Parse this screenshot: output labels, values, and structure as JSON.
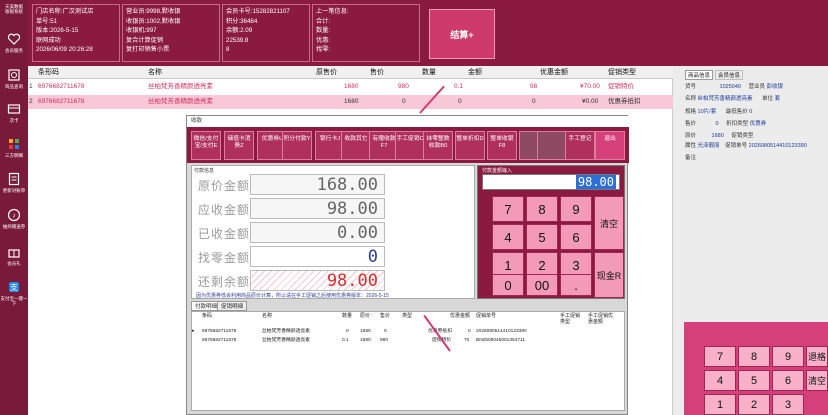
{
  "sidebar": {
    "logo_line1": "天美数据",
    "logo_line2": "收银系统",
    "items": [
      {
        "label": "会员服务",
        "icon": "heart-icon"
      },
      {
        "label": "商品查询",
        "icon": "search-icon"
      },
      {
        "label": "次卡",
        "icon": "card-icon"
      },
      {
        "label": "三方明细",
        "icon": "list-icon"
      },
      {
        "label": "更新对账单",
        "icon": "refresh-icon"
      },
      {
        "label": "抽商赠送券",
        "icon": "music-icon"
      },
      {
        "label": "会员礼",
        "icon": "gift-icon"
      },
      {
        "label": "支付宝一键一下",
        "icon": "alipay-icon"
      }
    ]
  },
  "topbar": {
    "store": [
      "门店名称:广汉测试店",
      "单号:51",
      "版本:2026-5-15",
      "联网成功",
      "2026/06/09 20:26:28"
    ],
    "cashier": [
      "营业员:9998,默收银",
      "收银员:1002,默收银",
      "收银机:997",
      "复合计算促销",
      "复打印销售小票"
    ],
    "member": [
      "会员卡号:15282821107",
      "积分:36484",
      "余额:2.09",
      "22539.8",
      "8"
    ],
    "last": [
      "上一笔信息:",
      "合计:",
      "数量:",
      "优惠:",
      "找零:"
    ],
    "settle_button": "结算+"
  },
  "grid": {
    "columns": [
      "条形码",
      "名称",
      "原售价",
      "售价",
      "数量",
      "金额",
      "优惠金额",
      "促销类型"
    ],
    "rows": [
      {
        "idx": "1",
        "barcode": "6976682711678",
        "name": "丝柏梵芳香精颜透亮素",
        "orig": "1680",
        "price": "980",
        "qty": "0.1",
        "amount": "98",
        "discount": "¥70.00",
        "promo": "促销特价"
      },
      {
        "idx": "2",
        "barcode": "6976682711678",
        "name": "丝柏梵芳香精颜透亮素",
        "orig": "1680",
        "price": "0",
        "qty": "0",
        "amount": "0",
        "discount": "¥0.00",
        "promo": "优惠券抵扣"
      }
    ]
  },
  "right_panel": {
    "tabs": [
      "商品信息",
      "会员信息"
    ],
    "lines": [
      {
        "k": "货号",
        "v": "1025040",
        "k2": "营业员",
        "v2": "彭收银"
      },
      {
        "k": "名称",
        "v": "丝柏梵芳香精颜透亮素",
        "k2": "单位",
        "v2": "套"
      },
      {
        "k": "规格",
        "v": "10片/套",
        "k2": "最低售价",
        "v2": "0"
      },
      {
        "k": "售价",
        "v": "0",
        "k2": "折扣类型",
        "v2": "优惠券"
      },
      {
        "k": "原价",
        "v": "1680",
        "k2": "促销类型",
        "v2": ""
      },
      {
        "k": "属性",
        "v": "光泽靓丽",
        "k2": "促销单号",
        "v2": "2026080514410123390"
      },
      {
        "k": "备注",
        "v": "",
        "k2": "",
        "v2": ""
      }
    ],
    "keypad": [
      "7",
      "8",
      "9",
      "退格",
      "4",
      "5",
      "6",
      "清空",
      "1",
      "2",
      "3"
    ]
  },
  "dialog": {
    "title": "收款",
    "toolbar": [
      {
        "label": "微信/支付宝/支付E"
      },
      {
        "label": "储值卡消费Z"
      },
      {
        "label": "优惠券L"
      },
      {
        "label": "积分付款Y"
      },
      {
        "label": "银行卡J"
      },
      {
        "label": "收款其它"
      },
      {
        "label": "有赠收款F7"
      },
      {
        "label": "手工促销C"
      },
      {
        "label": "抹零整数收款B0"
      },
      {
        "label": "整单折扣D"
      },
      {
        "label": "整单收银F8"
      },
      {
        "label": ""
      },
      {
        "label": ""
      },
      {
        "label": "手工登记"
      },
      {
        "label": "退出"
      }
    ],
    "section_label": "付款信息",
    "amounts": [
      {
        "label": "原价金额",
        "value": "168.00"
      },
      {
        "label": "应收金额",
        "value": "98.00"
      },
      {
        "label": "已收金额",
        "value": "0.00"
      },
      {
        "label": "找零金额",
        "value": "0"
      },
      {
        "label": "还剩余额",
        "value": "98.00"
      }
    ],
    "note": "因为优惠券低会利用商品原价计算，所以请在手工促销之后使用优惠券版本：2026-5-15",
    "input_label": "付款金额输入",
    "input_value": "98.00",
    "keypad": [
      "7",
      "8",
      "9",
      "清空",
      "4",
      "5",
      "6",
      "1",
      "2",
      "3",
      "现金R",
      "0",
      "00",
      "."
    ],
    "tabs": [
      "付款明细",
      "促销明细"
    ],
    "table_columns": [
      "条码",
      "名称",
      "数量",
      "原价",
      "售价",
      "类型",
      "优惠金额",
      "促销单号",
      "手工促销类型",
      "手工促销优惠金额"
    ],
    "table_rows": [
      {
        "barcode": "6976682711678",
        "name": "丝柏梵芳香精颜透亮素",
        "qty": "0",
        "orig": "1680",
        "price": "0",
        "type": "优惠券抵扣",
        "disc": "0",
        "no": "2026080514410123390"
      },
      {
        "barcode": "6976682711678",
        "name": "丝柏梵芳香精颜透亮素",
        "qty": "0.1",
        "orig": "1680",
        "price": "980",
        "type": "促销特价",
        "disc": "70",
        "no": "BN0505045001354711"
      }
    ]
  },
  "colors": {
    "brand": "#8a1a40",
    "accent": "#d6407a",
    "selected_row": "#f8c8d8",
    "key": "#f29ab8"
  }
}
